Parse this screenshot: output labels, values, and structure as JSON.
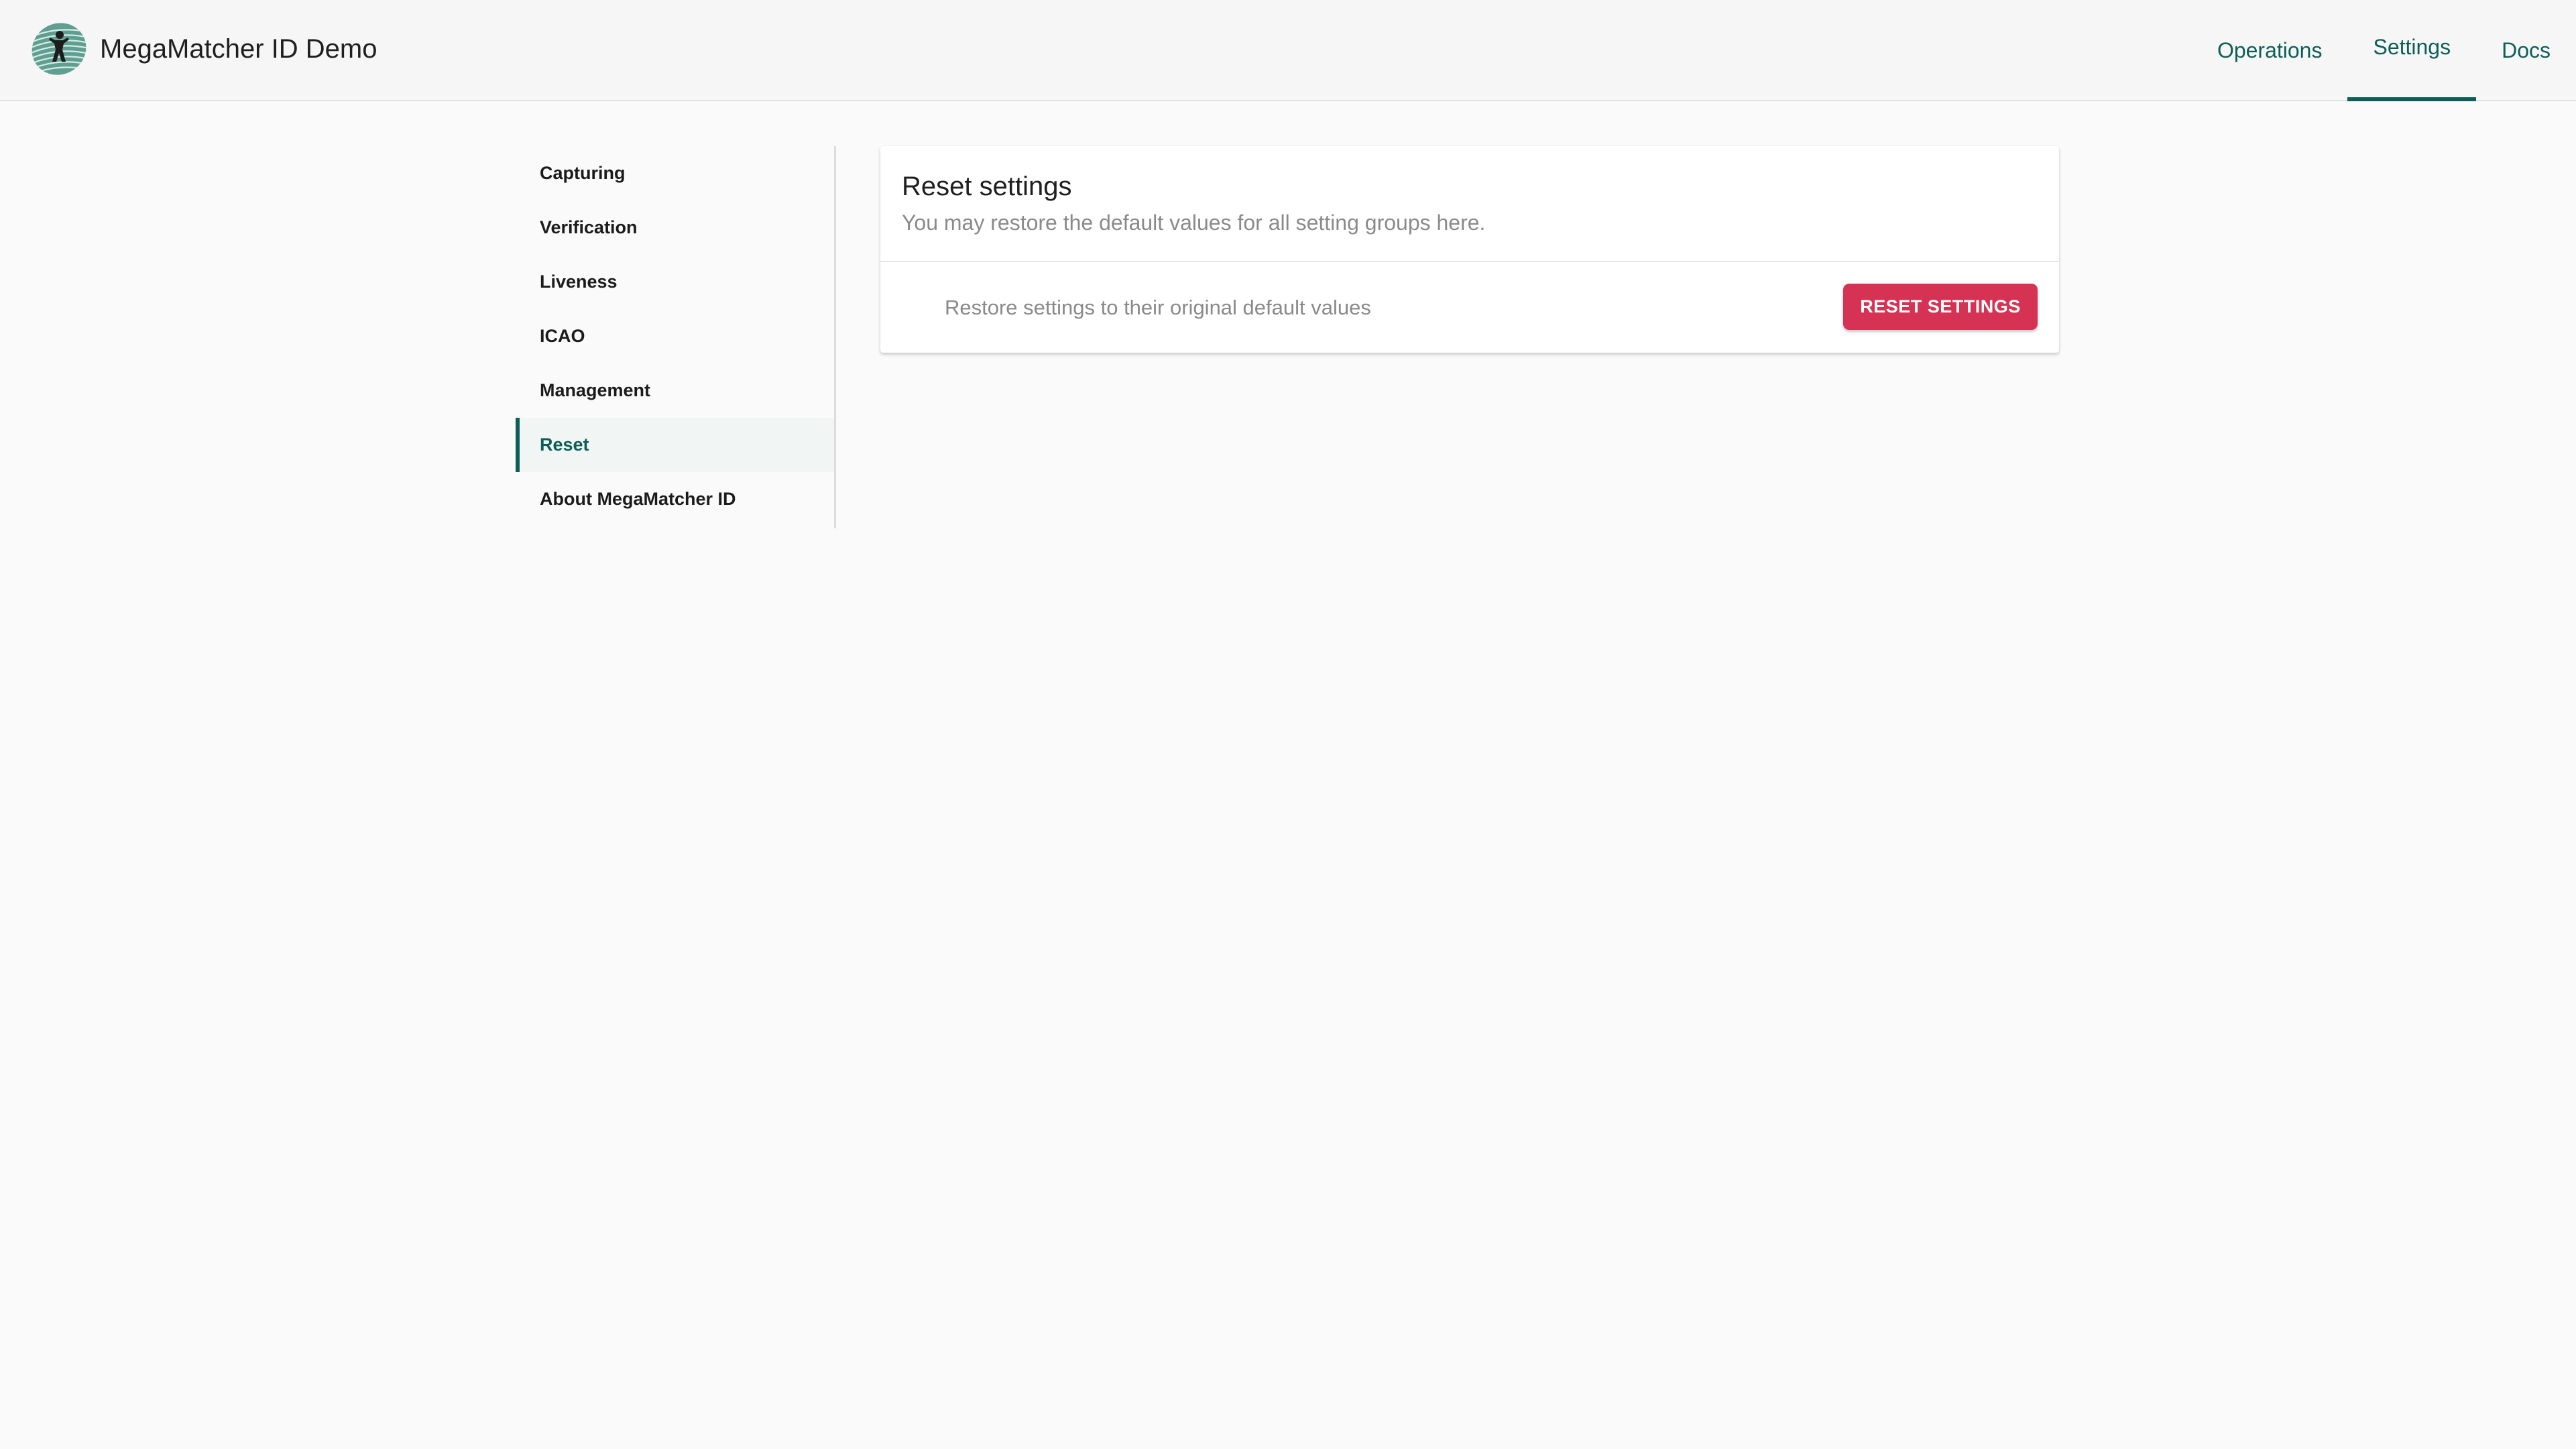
{
  "app": {
    "title": "MegaMatcher ID Demo",
    "logo_icon": "fingerprint-person-logo"
  },
  "nav": {
    "items": [
      {
        "label": "Operations",
        "active": false
      },
      {
        "label": "Settings",
        "active": true
      },
      {
        "label": "Docs",
        "active": false
      }
    ]
  },
  "sidebar": {
    "items": [
      {
        "label": "Capturing",
        "active": false
      },
      {
        "label": "Verification",
        "active": false
      },
      {
        "label": "Liveness",
        "active": false
      },
      {
        "label": "ICAO",
        "active": false
      },
      {
        "label": "Management",
        "active": false
      },
      {
        "label": "Reset",
        "active": true
      },
      {
        "label": "About MegaMatcher ID",
        "active": false
      }
    ]
  },
  "card": {
    "title": "Reset settings",
    "subtitle": "You may restore the default values for all setting groups here.",
    "row_label": "Restore settings to their original default values",
    "button_label": "RESET SETTINGS"
  },
  "colors": {
    "accent": "#0d5e58",
    "danger_button": "#d63354",
    "page_background": "#fafafa",
    "topbar_background": "#f6f6f6"
  }
}
